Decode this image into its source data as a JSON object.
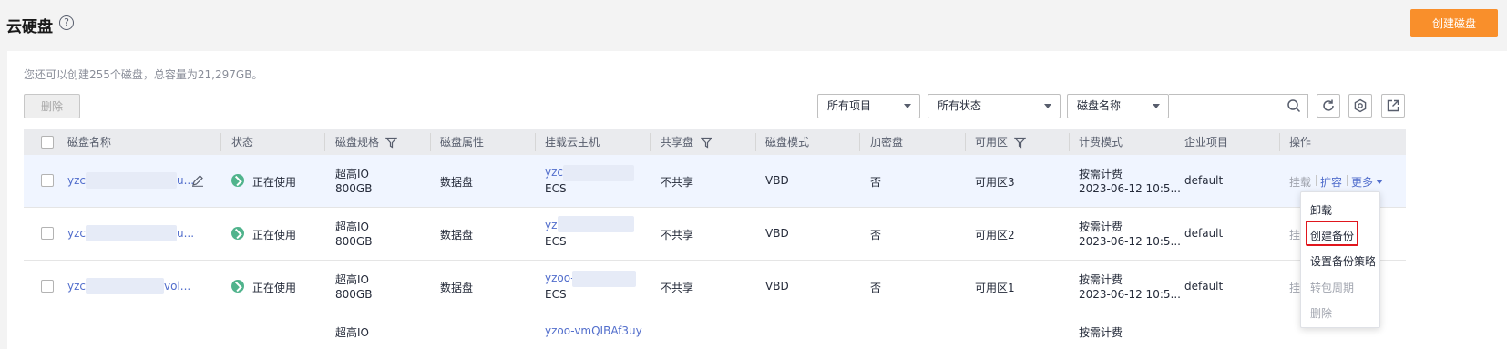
{
  "header": {
    "title": "云硬盘",
    "help_icon": "?",
    "create_button": "创建磁盘"
  },
  "quota_text": "您还可以创建255个磁盘，总容量为21,297GB。",
  "toolbar": {
    "delete_button": "删除",
    "project_select": "所有项目",
    "status_select": "所有状态",
    "search_field_select": "磁盘名称",
    "search_placeholder": ""
  },
  "table": {
    "columns": [
      "磁盘名称",
      "状态",
      "磁盘规格",
      "磁盘属性",
      "挂载云主机",
      "共享盘",
      "磁盘模式",
      "加密盘",
      "可用区",
      "计费模式",
      "企业项目",
      "操作"
    ],
    "rows": [
      {
        "name_prefix": "yzc",
        "name_suffix": "u...",
        "status": "正在使用",
        "spec_type": "超高IO",
        "spec_size": "800GB",
        "attribute": "数据盘",
        "host_prefix": "yzc",
        "host_suffix": "",
        "host_type": "ECS",
        "shared": "不共享",
        "mode": "VBD",
        "encrypted": "否",
        "zone": "可用区3",
        "billing": "按需计费",
        "billing_time": "2023-06-12 10:5...",
        "project": "default"
      },
      {
        "name_prefix": "yzc",
        "name_suffix": "u...",
        "status": "正在使用",
        "spec_type": "超高IO",
        "spec_size": "800GB",
        "attribute": "数据盘",
        "host_prefix": "yz",
        "host_suffix": "",
        "host_type": "ECS",
        "shared": "不共享",
        "mode": "VBD",
        "encrypted": "否",
        "zone": "可用区2",
        "billing": "按需计费",
        "billing_time": "2023-06-12 10:5...",
        "project": "default"
      },
      {
        "name_prefix": "yzc",
        "name_suffix": "vol...",
        "status": "正在使用",
        "spec_type": "超高IO",
        "spec_size": "800GB",
        "attribute": "数据盘",
        "host_prefix": "yzoo-",
        "host_suffix": "",
        "host_type": "ECS",
        "shared": "不共享",
        "mode": "VBD",
        "encrypted": "否",
        "zone": "可用区1",
        "billing": "按需计费",
        "billing_time": "2023-06-12 10:5...",
        "project": "default"
      },
      {
        "name_prefix": "",
        "name_suffix": "",
        "status": "",
        "spec_type": "超高IO",
        "spec_size": "",
        "attribute": "",
        "host_prefix": "yzoo-vmQIBAf3uy",
        "host_suffix": "",
        "host_type": "",
        "shared": "",
        "mode": "",
        "encrypted": "",
        "zone": "",
        "billing": "按需计费",
        "billing_time": "",
        "project": ""
      }
    ],
    "ops": {
      "mount": "挂载",
      "mount_short": "挂",
      "expand": "扩容",
      "more": "更多"
    }
  },
  "dropdown": {
    "items": [
      {
        "label": "卸载",
        "disabled": false
      },
      {
        "label": "创建备份",
        "disabled": false
      },
      {
        "label": "设置备份策略",
        "disabled": false
      },
      {
        "label": "转包周期",
        "disabled": true
      },
      {
        "label": "删除",
        "disabled": true
      }
    ]
  },
  "colors": {
    "accent": "#f98f2b",
    "link": "#526ecc",
    "success": "#50b38c",
    "highlight": "#e0161d"
  }
}
